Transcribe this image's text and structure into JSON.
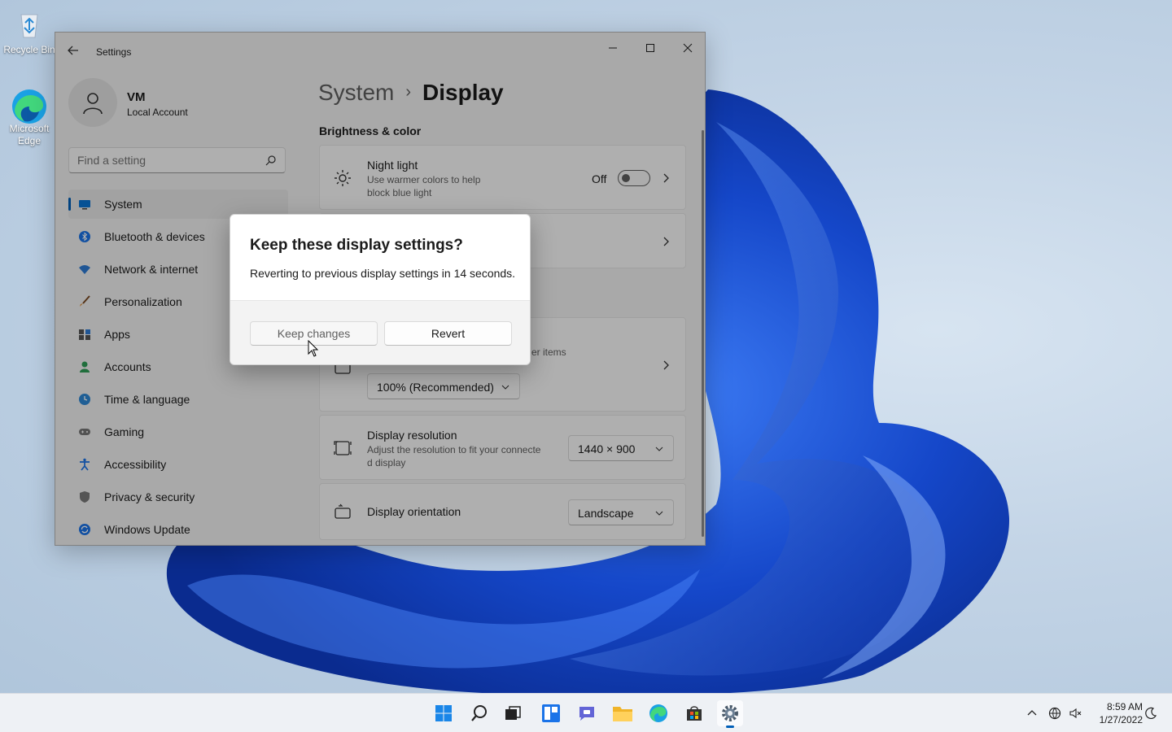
{
  "desktop": {
    "icons": [
      {
        "label": "Recycle Bin",
        "icon": "recycle-bin-icon"
      },
      {
        "label_line1": "Microsoft",
        "label_line2": "Edge",
        "icon": "edge-icon"
      }
    ]
  },
  "window": {
    "title": "Settings",
    "back_icon": "back-arrow-icon",
    "controls": [
      "minimize",
      "maximize",
      "close"
    ]
  },
  "user": {
    "name": "VM",
    "account_type": "Local Account"
  },
  "search": {
    "placeholder": "Find a setting"
  },
  "sidebar": {
    "items": [
      {
        "label": "System",
        "icon": "system-icon",
        "active": true
      },
      {
        "label": "Bluetooth & devices",
        "icon": "bluetooth-icon"
      },
      {
        "label": "Network & internet",
        "icon": "wifi-icon"
      },
      {
        "label": "Personalization",
        "icon": "brush-icon"
      },
      {
        "label": "Apps",
        "icon": "apps-icon"
      },
      {
        "label": "Accounts",
        "icon": "person-icon"
      },
      {
        "label": "Time & language",
        "icon": "globe-clock-icon"
      },
      {
        "label": "Gaming",
        "icon": "gamepad-icon"
      },
      {
        "label": "Accessibility",
        "icon": "accessibility-icon"
      },
      {
        "label": "Privacy & security",
        "icon": "shield-icon"
      },
      {
        "label": "Windows Update",
        "icon": "update-icon"
      }
    ]
  },
  "main": {
    "breadcrumb": {
      "parent": "System",
      "separator": "›",
      "current": "Display"
    },
    "section_brightness": "Brightness & color",
    "night_light": {
      "title": "Night light",
      "subtitle_line1": "Use warmer colors to help",
      "subtitle_line2": "block blue light",
      "state": "Off"
    },
    "scale_partial_text": "er items",
    "scale_value": "100% (Recommended)",
    "resolution": {
      "title": "Display resolution",
      "subtitle_line1": "Adjust the resolution to fit your connecte",
      "subtitle_line2": "d display",
      "value": "1440 × 900"
    },
    "orientation": {
      "title": "Display orientation",
      "value": "Landscape"
    }
  },
  "dialog": {
    "title": "Keep these display settings?",
    "message": "Reverting to previous display settings in 14 seconds.",
    "keep_label": "Keep changes",
    "revert_label": "Revert"
  },
  "taskbar": {
    "apps": [
      "start-icon",
      "search-icon",
      "task-view-icon",
      "widgets-icon",
      "chat-icon",
      "file-explorer-icon",
      "edge-icon",
      "store-icon",
      "settings-icon"
    ],
    "active_app": "settings-icon",
    "time": "8:59 AM",
    "date": "1/27/2022"
  },
  "colors": {
    "accent": "#005fb8",
    "bloom_dark": "#0a2a9c",
    "bloom_light": "#2f6bf0"
  }
}
